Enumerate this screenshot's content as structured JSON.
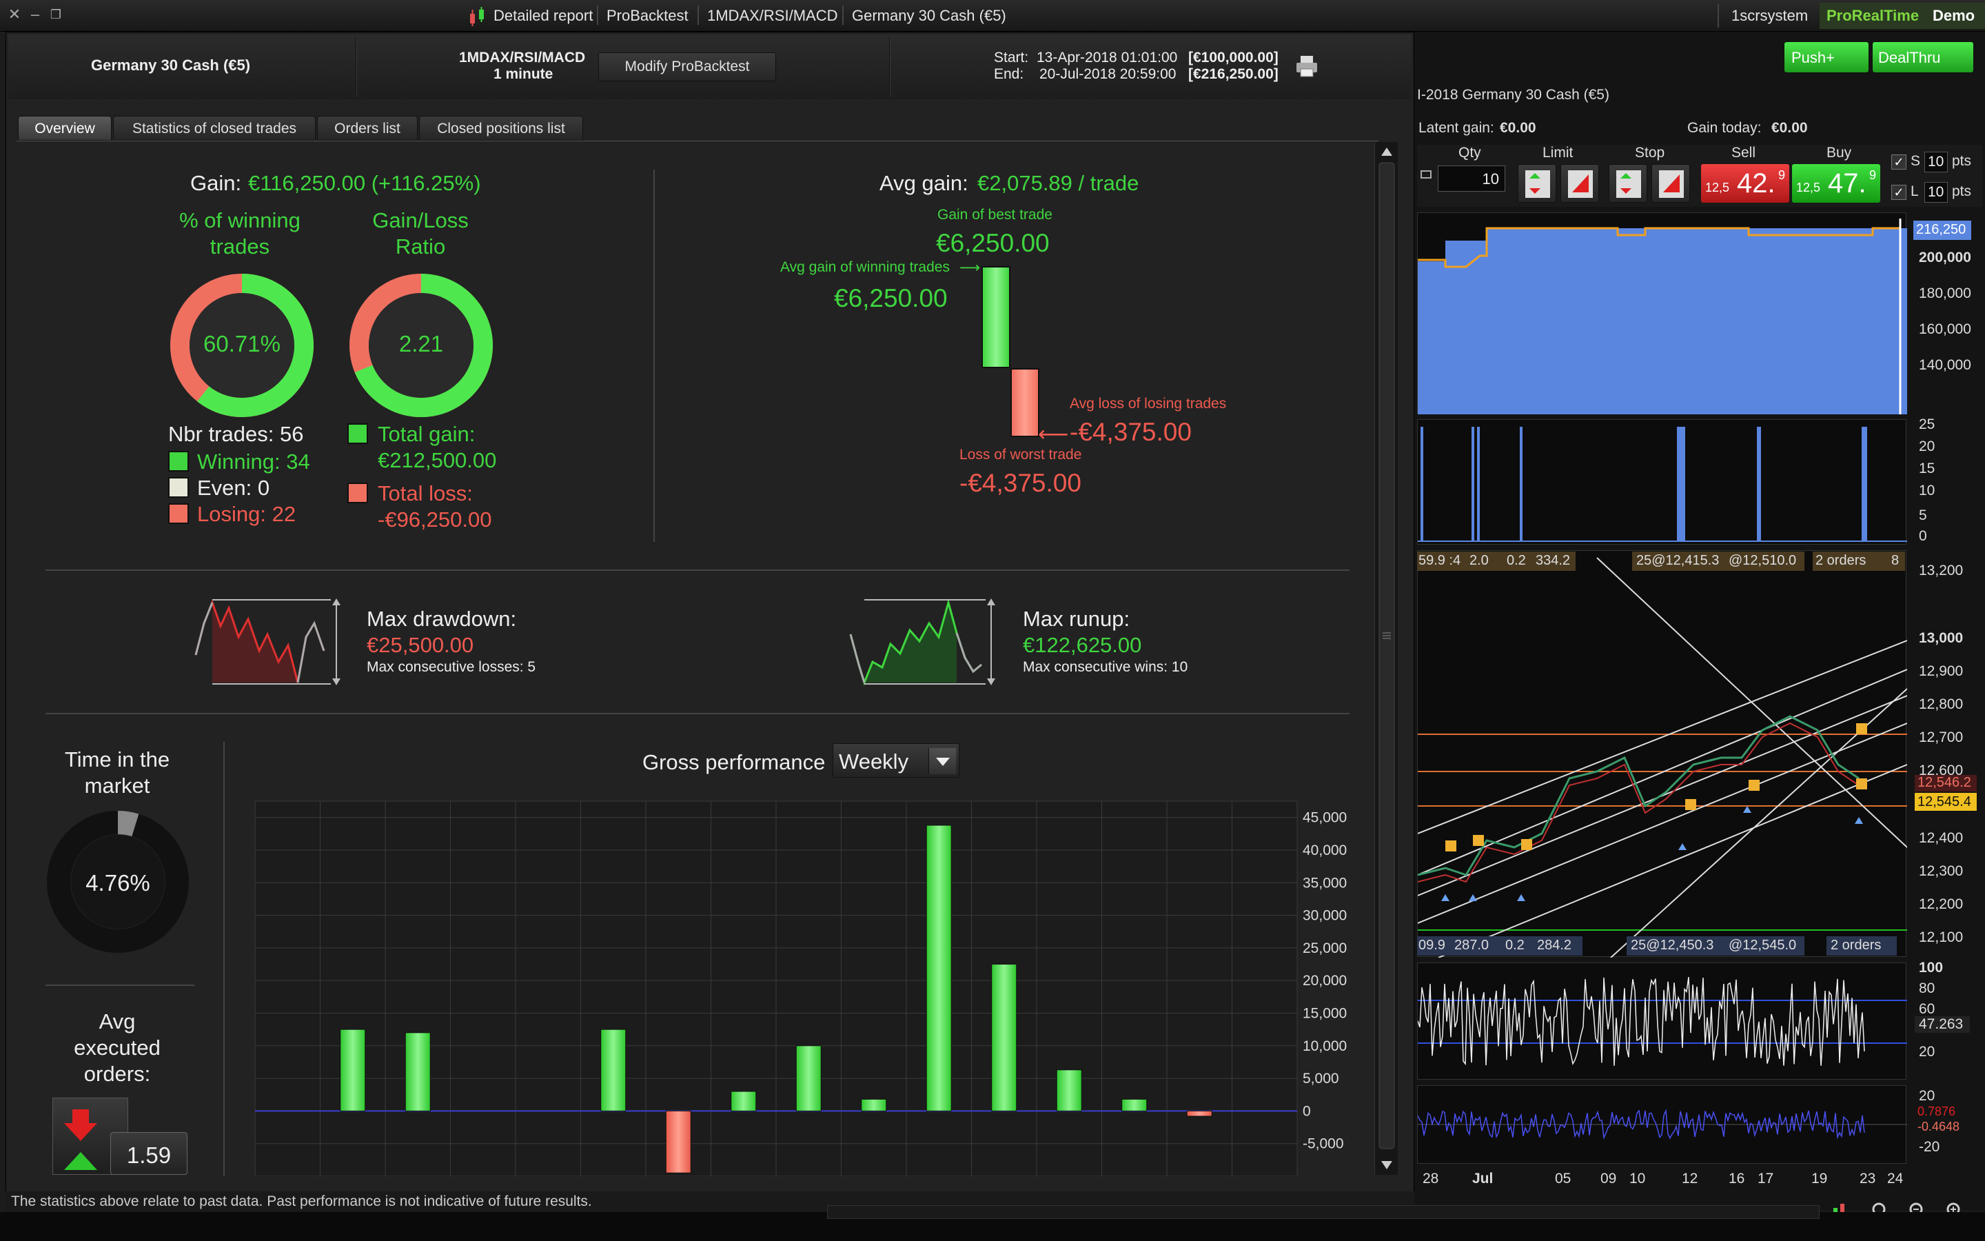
{
  "titlebar": {
    "crumbs": [
      "Detailed report",
      "ProBacktest",
      "1MDAX/RSI/MACD",
      "Germany 30 Cash (€5)"
    ],
    "account": "1scrsystem",
    "brand": "ProRealTime",
    "mode": "Demo"
  },
  "header": {
    "instrument": "Germany 30 Cash (€5)",
    "strategy": "1MDAX/RSI/MACD",
    "timeframe": "1 minute",
    "modify_button": "Modify ProBacktest",
    "start_label": "Start:",
    "start_value": "13-Apr-2018 01:01:00",
    "start_capital": "[€100,000.00]",
    "end_label": "End:",
    "end_value": "20-Jul-2018 20:59:00",
    "end_capital": "[€216,250.00]"
  },
  "tabs": [
    "Overview",
    "Statistics of closed trades",
    "Orders list",
    "Closed positions list"
  ],
  "overview": {
    "gain_label": "Gain:",
    "gain_value": "€116,250.00 (+116.25%)",
    "winning_pct_label1": "% of winning",
    "winning_pct_label2": "trades",
    "winning_pct_value": "60.71%",
    "winning_fraction": 0.6071,
    "gl_ratio_label1": "Gain/Loss",
    "gl_ratio_label2": "Ratio",
    "gl_ratio_value": "2.21",
    "gl_fraction": 0.6883,
    "nbr_trades": "Nbr trades: 56",
    "winning": "Winning: 34",
    "even": "Even: 0",
    "losing": "Losing: 22",
    "total_gain_label": "Total gain:",
    "total_gain_value": "€212,500.00",
    "total_loss_label": "Total loss:",
    "total_loss_value": "-€96,250.00",
    "avg_gain_label": "Avg gain:",
    "avg_gain_value": "€2,075.89 / trade",
    "best_trade_label": "Gain of best trade",
    "best_trade_value": "€6,250.00",
    "avg_win_label": "Avg gain of winning trades",
    "avg_win_value": "€6,250.00",
    "avg_loss_label": "Avg loss of losing trades",
    "avg_loss_value": "-€4,375.00",
    "worst_trade_label": "Loss of worst trade",
    "worst_trade_value": "-€4,375.00",
    "max_drawdown_label": "Max drawdown:",
    "max_drawdown_value": "€25,500.00",
    "max_consec_losses": "Max consecutive losses: 5",
    "max_runup_label": "Max runup:",
    "max_runup_value": "€122,625.00",
    "max_consec_wins": "Max consecutive wins: 10",
    "time_market_label1": "Time in the",
    "time_market_label2": "market",
    "time_market_value": "4.76%",
    "time_market_fraction": 0.0476,
    "avg_exec_label1": "Avg",
    "avg_exec_label2": "executed",
    "avg_exec_label3": "orders:",
    "avg_exec_value": "1.59",
    "gross_perf_label": "Gross performance",
    "gross_perf_period": "Weekly"
  },
  "footer": "The statistics above relate to past data. Past performance is not indicative of future results.",
  "chart_data": {
    "type": "bar",
    "title": "Gross performance",
    "xlabel": "",
    "ylabel": "",
    "ylim": [
      -10000,
      47500
    ],
    "yticks": [
      45000,
      40000,
      35000,
      30000,
      25000,
      20000,
      15000,
      10000,
      5000,
      0,
      -5000
    ],
    "ytick_labels": [
      "45,000",
      "40,000",
      "35,000",
      "30,000",
      "25,000",
      "20,000",
      "15,000",
      "10,000",
      "5,000",
      "0",
      "-5,000"
    ],
    "values": [
      0,
      12500,
      12000,
      0,
      0,
      12500,
      -9500,
      3000,
      10000,
      1800,
      43800,
      22500,
      6300,
      1800,
      -800,
      0
    ],
    "grid": true
  },
  "side": {
    "push_button": "Push+",
    "dealthru_button": "DealThru",
    "chart_title": "I-2018  Germany 30 Cash (€5)",
    "latent_gain_label": "Latent gain:",
    "latent_gain_value": "€0.00",
    "gain_today_label": "Gain today:",
    "gain_today_value": "€0.00",
    "qty_label": "Qty",
    "qty_value": "10",
    "limit_label": "Limit",
    "stop_label": "Stop",
    "sell_label": "Sell",
    "buy_label": "Buy",
    "sell_prefix": "12,5",
    "sell_big": "42.",
    "sell_sup": "9",
    "buy_prefix": "12,5",
    "buy_big": "47.",
    "buy_sup": "9",
    "s_label": "S",
    "s_value": "10",
    "l_label": "L",
    "l_value": "10",
    "pts": "pts",
    "equity_axis": [
      "216,250",
      "200,000",
      "180,000",
      "160,000",
      "140,000"
    ],
    "positions_axis": [
      "25",
      "20",
      "15",
      "10",
      "5",
      "0"
    ],
    "price_axis": [
      "13,200",
      "13,000",
      "12,900",
      "12,800",
      "12,700",
      "12,600",
      "12,546.2",
      "12,545.4",
      "12,400",
      "12,300",
      "12,200",
      "12,100"
    ],
    "orders_top": [
      "59.9 :4",
      "2.0",
      "0.2",
      "334.2",
      "25@12,415.3",
      "@12,510.0",
      "2 orders",
      "8"
    ],
    "orders_bottom": [
      "09.9",
      "287.0",
      "0.2",
      "284.2",
      "25@12,450.3",
      "@12,545.0",
      "2 orders"
    ],
    "rsi_axis": [
      "100",
      "80",
      "60",
      "47.263",
      "20"
    ],
    "macd_axis": [
      "20",
      "0.7876",
      "-0.4648",
      "-20"
    ],
    "date_axis": [
      "28",
      "Jul",
      "05",
      "09",
      "10",
      "12",
      "16",
      "17",
      "19",
      "23",
      "24"
    ]
  }
}
